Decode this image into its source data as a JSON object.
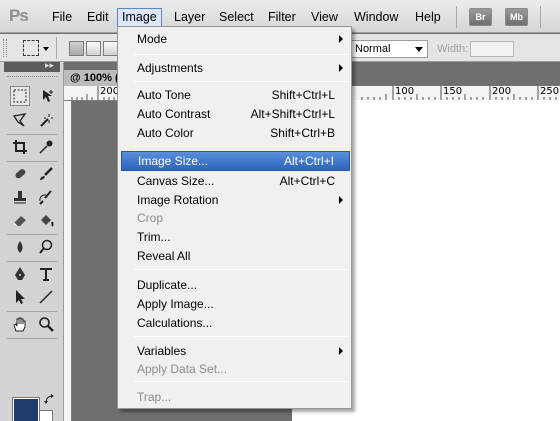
{
  "app": {
    "logo_text": "Ps"
  },
  "menubar": {
    "items": [
      {
        "label": "File"
      },
      {
        "label": "Edit"
      },
      {
        "label": "Image"
      },
      {
        "label": "Layer"
      },
      {
        "label": "Select"
      },
      {
        "label": "Filter"
      },
      {
        "label": "View"
      },
      {
        "label": "Window"
      },
      {
        "label": "Help"
      }
    ],
    "active": "Image",
    "app_buttons": [
      {
        "label": "Br"
      },
      {
        "label": "Mb"
      }
    ]
  },
  "options": {
    "style_value": "Normal",
    "width_label": "Width:",
    "width_value": ""
  },
  "document": {
    "tab_label": "@ 100% (",
    "ruler_ticks": [
      "200",
      "100",
      "150",
      "200",
      "250"
    ]
  },
  "colors": {
    "foreground": "#203c6f",
    "background": "#ffffff",
    "highlight": "#3e73c8"
  },
  "image_menu": {
    "groups": [
      {
        "items": [
          {
            "label": "Mode",
            "submenu": true
          }
        ]
      },
      {
        "items": [
          {
            "label": "Adjustments",
            "submenu": true
          }
        ]
      },
      {
        "items": [
          {
            "label": "Auto Tone",
            "shortcut": "Shift+Ctrl+L"
          },
          {
            "label": "Auto Contrast",
            "shortcut": "Alt+Shift+Ctrl+L"
          },
          {
            "label": "Auto Color",
            "shortcut": "Shift+Ctrl+B"
          }
        ]
      },
      {
        "items": [
          {
            "label": "Image Size...",
            "shortcut": "Alt+Ctrl+I",
            "highlighted": true
          },
          {
            "label": "Canvas Size...",
            "shortcut": "Alt+Ctrl+C"
          },
          {
            "label": "Image Rotation",
            "submenu": true
          },
          {
            "label": "Crop",
            "disabled": true
          },
          {
            "label": "Trim..."
          },
          {
            "label": "Reveal All"
          }
        ]
      },
      {
        "items": [
          {
            "label": "Duplicate..."
          },
          {
            "label": "Apply Image..."
          },
          {
            "label": "Calculations..."
          }
        ]
      },
      {
        "items": [
          {
            "label": "Variables",
            "submenu": true
          },
          {
            "label": "Apply Data Set...",
            "disabled": true
          }
        ]
      },
      {
        "items": [
          {
            "label": "Trap...",
            "disabled": true
          }
        ]
      }
    ]
  },
  "tools": [
    "rectangular-marquee-icon",
    "move-icon",
    "lasso-icon",
    "magic-wand-icon",
    "crop-icon",
    "eyedropper-icon",
    "healing-brush-icon",
    "brush-icon",
    "clone-stamp-icon",
    "history-brush-icon",
    "eraser-icon",
    "paint-bucket-icon",
    "blur-icon",
    "dodge-icon",
    "pen-icon",
    "type-icon",
    "path-selection-icon",
    "line-icon",
    "hand-icon",
    "zoom-icon"
  ]
}
